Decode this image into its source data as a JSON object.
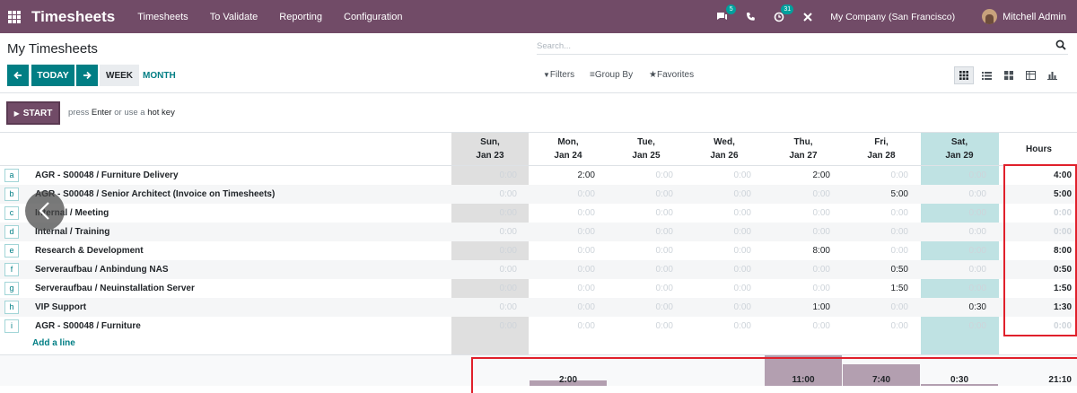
{
  "navbar": {
    "brand": "Timesheets",
    "menus": [
      "Timesheets",
      "To Validate",
      "Reporting",
      "Configuration"
    ],
    "chat_badge": "5",
    "activity_badge": "31",
    "company": "My Company (San Francisco)",
    "user": "Mitchell Admin"
  },
  "page": {
    "title": "My Timesheets"
  },
  "search": {
    "placeholder": "Search..."
  },
  "nav": {
    "today": "TODAY",
    "week": "WEEK",
    "month": "MONTH"
  },
  "filters": {
    "filters": "Filters",
    "group_by": "Group By",
    "favorites": "Favorites"
  },
  "timer": {
    "start": "START",
    "hint_pre": "press",
    "hint_key": "Enter",
    "hint_mid": "or use a",
    "hint_key2": "hot key"
  },
  "columns": [
    {
      "day": "Sun,",
      "date": "Jan 23"
    },
    {
      "day": "Mon,",
      "date": "Jan 24"
    },
    {
      "day": "Tue,",
      "date": "Jan 25"
    },
    {
      "day": "Wed,",
      "date": "Jan 26"
    },
    {
      "day": "Thu,",
      "date": "Jan 27"
    },
    {
      "day": "Fri,",
      "date": "Jan 28"
    },
    {
      "day": "Sat,",
      "date": "Jan 29"
    }
  ],
  "hours_header": "Hours",
  "rows": [
    {
      "key": "a",
      "label": "AGR - S00048 / Furniture Delivery",
      "cells": [
        "0:00",
        "2:00",
        "0:00",
        "0:00",
        "2:00",
        "0:00",
        "0:00"
      ],
      "total": "4:00"
    },
    {
      "key": "b",
      "label": "AGR - S00048 / Senior Architect (Invoice on Timesheets)",
      "cells": [
        "0:00",
        "0:00",
        "0:00",
        "0:00",
        "0:00",
        "5:00",
        "0:00"
      ],
      "total": "5:00"
    },
    {
      "key": "c",
      "label": "Internal / Meeting",
      "cells": [
        "0:00",
        "0:00",
        "0:00",
        "0:00",
        "0:00",
        "0:00",
        "0:00"
      ],
      "total": "0:00"
    },
    {
      "key": "d",
      "label": "Internal / Training",
      "cells": [
        "0:00",
        "0:00",
        "0:00",
        "0:00",
        "0:00",
        "0:00",
        "0:00"
      ],
      "total": "0:00"
    },
    {
      "key": "e",
      "label": "Research & Development",
      "cells": [
        "0:00",
        "0:00",
        "0:00",
        "0:00",
        "8:00",
        "0:00",
        "0:00"
      ],
      "total": "8:00"
    },
    {
      "key": "f",
      "label": "Serveraufbau / Anbindung NAS",
      "cells": [
        "0:00",
        "0:00",
        "0:00",
        "0:00",
        "0:00",
        "0:50",
        "0:00"
      ],
      "total": "0:50"
    },
    {
      "key": "g",
      "label": "Serveraufbau / Neuinstallation Server",
      "cells": [
        "0:00",
        "0:00",
        "0:00",
        "0:00",
        "0:00",
        "1:50",
        "0:00"
      ],
      "total": "1:50"
    },
    {
      "key": "h",
      "label": "VIP Support",
      "cells": [
        "0:00",
        "0:00",
        "0:00",
        "0:00",
        "1:00",
        "0:00",
        "0:30"
      ],
      "total": "1:30"
    },
    {
      "key": "i",
      "label": "AGR - S00048 / Furniture",
      "cells": [
        "0:00",
        "0:00",
        "0:00",
        "0:00",
        "0:00",
        "0:00",
        "0:00"
      ],
      "total": "0:00"
    }
  ],
  "add_line": "Add a line",
  "totals": {
    "days": [
      "",
      "2:00",
      "",
      "",
      "11:00",
      "7:40",
      "0:30"
    ],
    "grand": "21:10"
  },
  "colors": {
    "brand": "#714b67",
    "accent": "#017e84",
    "highlight": "#e0202b"
  }
}
